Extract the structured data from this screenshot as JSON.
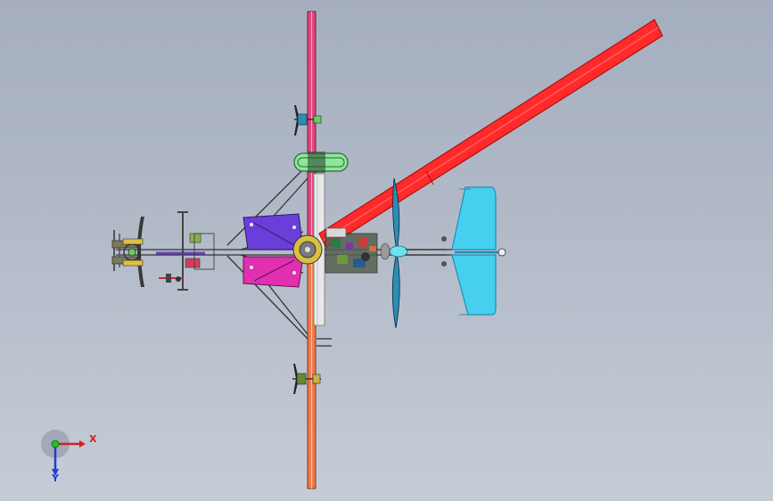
{
  "viewport": {
    "background_top": "#a5aebf",
    "background_bottom": "#c6ccd7"
  },
  "model": {
    "colors": {
      "rotor_blade": "#ff2b2b",
      "rotor_blade_edge": "#c41414",
      "mast_upper": "#e0447a",
      "mast_lower": "#f07a4a",
      "tail": "#46cfee",
      "tail_edge": "#1c8fb8",
      "seat_top": "#6a3ed8",
      "seat_bottom": "#e030b0",
      "propeller": "#2a8fb0",
      "fuel_tank": "#8ee69a",
      "frame": "#333333"
    }
  },
  "triad": {
    "x_label": "X",
    "y_label": "Y",
    "x_color": "#d42020",
    "y_color": "#20c020",
    "z_color": "#2040d0"
  }
}
